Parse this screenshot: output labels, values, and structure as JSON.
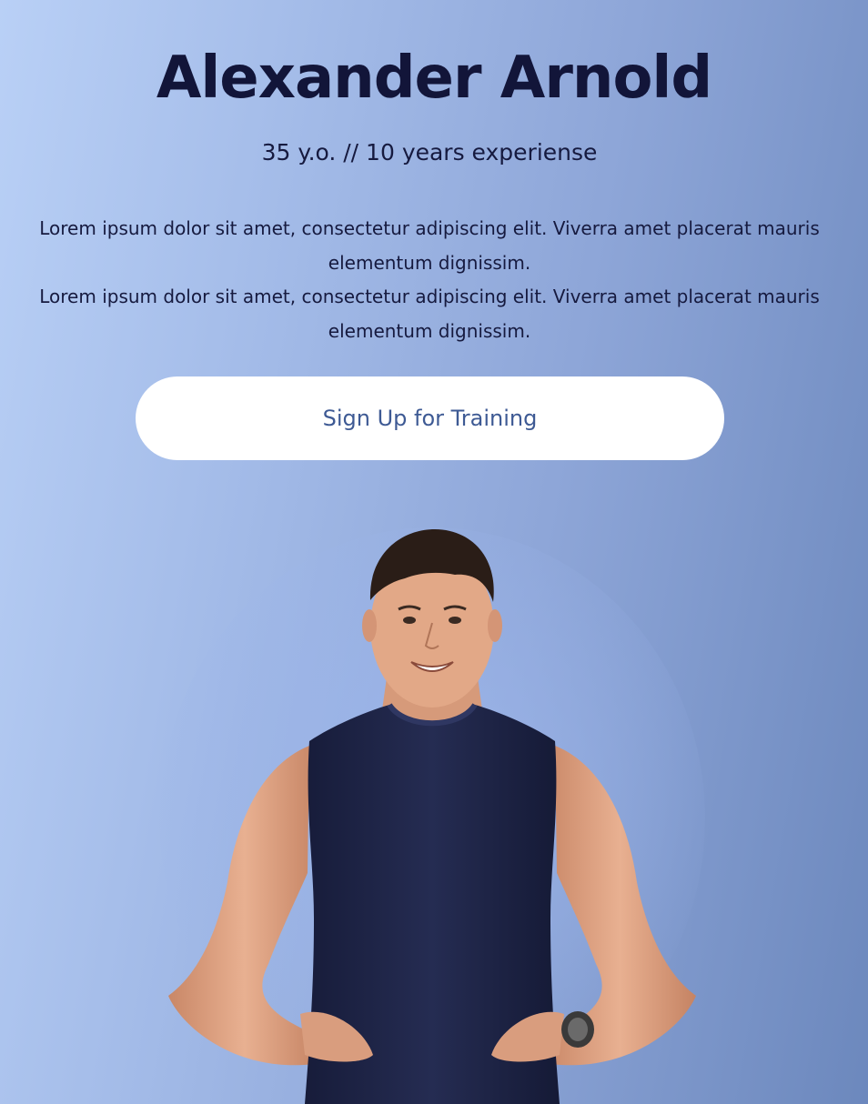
{
  "trainer": {
    "name": "Alexander Arnold",
    "meta": "35 y.o. // 10 years experiense",
    "bio_line1": "Lorem ipsum dolor sit amet, consectetur adipiscing elit. Viverra amet placerat mauris elementum dignissim.",
    "bio_line2": "Lorem ipsum dolor sit amet, consectetur adipiscing elit. Viverra amet placerat mauris elementum dignissim."
  },
  "cta": {
    "label": "Sign Up for Training"
  },
  "photo": {
    "subject": "trainer-portrait"
  },
  "colors": {
    "background_start": "#b9d0f6",
    "background_end": "#6c88bd",
    "heading": "#121539",
    "button_bg": "#ffffff",
    "button_text": "#3e5a94",
    "shirt": "#1f2547",
    "skin": "#e0a585"
  }
}
